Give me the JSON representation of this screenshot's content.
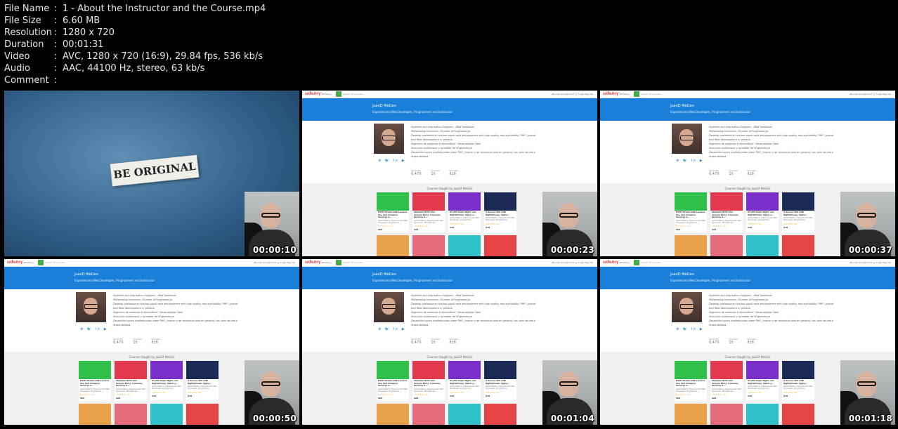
{
  "meta": [
    {
      "label": "File Name",
      "value": "1 - About the Instructor and the Course.mp4"
    },
    {
      "label": "File Size",
      "value": "6.60 MB"
    },
    {
      "label": "Resolution",
      "value": "1280 x 720"
    },
    {
      "label": "Duration",
      "value": "00:01:31"
    },
    {
      "label": "Video",
      "value": "AVC, 1280 x 720 (16:9), 29.84 fps, 536 kb/s"
    },
    {
      "label": "Audio",
      "value": "AAC, 44100 Hz, stereo, 63 kb/s"
    },
    {
      "label": "Comment",
      "value": ""
    }
  ],
  "separator": ":",
  "intro_text": "BE ORIGINAL",
  "page": {
    "logo": "udemy",
    "browse": "Browse ▾",
    "search_placeholder": "Search for Courses",
    "nav_right": "Become an Instructor    🛒    Login    Sign Up",
    "instructor_name": "JuanD MeGon",
    "instructor_title": "Experienced Web Developer, Programmer and Instructor",
    "bio": [
      "Systems and Informatics Engineer - Web Developer",
      "Professional Instructor, Founder of Programarya",
      "Develop professional courses about web development with high quality and availability, PHP, Laravel",
      "and Web Development in general.",
      "",
      "Ingeniero de sistemas e informática - Desarrollador Web",
      "Instructor profesional y fundador de Programarya",
      "Desarrollo cursos profesionales sobre PHP, Laravel y de desarrollo web en general, con alta calidad y",
      "disponibilidad."
    ],
    "socials": "⊕ 🐦 in ▶",
    "stats": [
      {
        "label": "Students",
        "value": "6,479"
      },
      {
        "label": "Courses",
        "value": "10"
      },
      {
        "label": "Reviews",
        "value": "828"
      }
    ],
    "courses_title": "Courses taught by JuanD MeGon",
    "cards": [
      {
        "title": "HTTP Clients with Laravel: Use and Consume Services a...",
        "author": "JuanD MeGon, Experienced Web Developer, Programme...",
        "rating": "★★★★★ (74)",
        "price": "$65",
        "color": "#2fbf4a"
      },
      {
        "title": "Ultimate HTTP and Laravel Story: Consume Services &...",
        "author": "JuanD MeGon, Experienced Web Developer, Programme...",
        "rating": "★★★★★ (38)",
        "price": "$65",
        "color": "#e2394f"
      },
      {
        "title": "To VPS Super Nginx con DigitalOcean, Nginx y...",
        "author": "JuanD MeGon, Experienced Web Developer, Programme...",
        "rating": "★★★★★ (19)",
        "price": "$70",
        "color": "#7b2fc9"
      },
      {
        "title": "A Secure VPS with DigitalOcean, Nginx...",
        "author": "JuanD MeGon, Experienced Web Developer, Programme...",
        "rating": "★★★★★ (20)",
        "price": "$70",
        "color": "#1b2a55"
      }
    ],
    "cards_row2_colors": [
      "#e9a24a",
      "#e56b78",
      "#2fc3c9",
      "#e54545"
    ]
  },
  "timestamps": [
    "00:00:10",
    "00:00:23",
    "00:00:37",
    "00:00:50",
    "00:01:04",
    "00:01:18"
  ]
}
